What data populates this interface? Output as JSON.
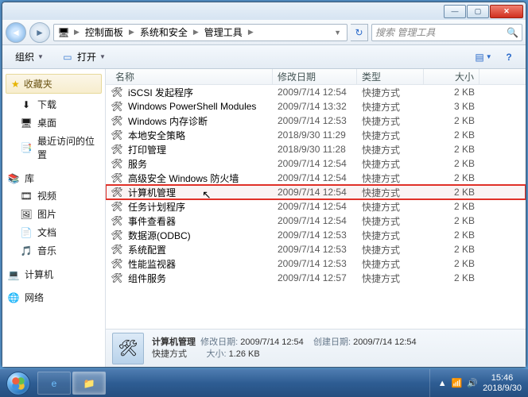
{
  "window_controls": {
    "min": "—",
    "max": "▢",
    "close": "✕"
  },
  "nav": {
    "back": "◄",
    "fwd": "►"
  },
  "breadcrumb": {
    "root_icon": "🖥",
    "items": [
      "控制面板",
      "系统和安全",
      "管理工具"
    ]
  },
  "search": {
    "icon": "🔍",
    "placeholder": "搜索 管理工具"
  },
  "toolbar": {
    "organize": "组织",
    "open": "打开",
    "view_icon": "▤",
    "help_icon": "?"
  },
  "sidebar": {
    "favorites": {
      "label": "收藏夹",
      "star": "★"
    },
    "fav_items": [
      {
        "label": "下载",
        "icon": "⬇"
      },
      {
        "label": "桌面",
        "icon": "🖥"
      },
      {
        "label": "最近访问的位置",
        "icon": "📑"
      }
    ],
    "libraries": {
      "label": "库",
      "icon": "📚"
    },
    "lib_items": [
      {
        "label": "视频",
        "icon": "🎞"
      },
      {
        "label": "图片",
        "icon": "🖼"
      },
      {
        "label": "文档",
        "icon": "📄"
      },
      {
        "label": "音乐",
        "icon": "🎵"
      }
    ],
    "computer": {
      "label": "计算机",
      "icon": "💻"
    },
    "network": {
      "label": "网络",
      "icon": "🌐"
    }
  },
  "columns": {
    "name": "名称",
    "date": "修改日期",
    "type": "类型",
    "size": "大小"
  },
  "files": [
    {
      "name": "iSCSI 发起程序",
      "date": "2009/7/14 12:54",
      "type": "快捷方式",
      "size": "2 KB",
      "hl": false
    },
    {
      "name": "Windows PowerShell Modules",
      "date": "2009/7/14 13:32",
      "type": "快捷方式",
      "size": "3 KB",
      "hl": false
    },
    {
      "name": "Windows 内存诊断",
      "date": "2009/7/14 12:53",
      "type": "快捷方式",
      "size": "2 KB",
      "hl": false
    },
    {
      "name": "本地安全策略",
      "date": "2018/9/30 11:29",
      "type": "快捷方式",
      "size": "2 KB",
      "hl": false
    },
    {
      "name": "打印管理",
      "date": "2018/9/30 11:28",
      "type": "快捷方式",
      "size": "2 KB",
      "hl": false
    },
    {
      "name": "服务",
      "date": "2009/7/14 12:54",
      "type": "快捷方式",
      "size": "2 KB",
      "hl": false
    },
    {
      "name": "高级安全 Windows 防火墙",
      "date": "2009/7/14 12:54",
      "type": "快捷方式",
      "size": "2 KB",
      "hl": false
    },
    {
      "name": "计算机管理",
      "date": "2009/7/14 12:54",
      "type": "快捷方式",
      "size": "2 KB",
      "hl": true
    },
    {
      "name": "任务计划程序",
      "date": "2009/7/14 12:54",
      "type": "快捷方式",
      "size": "2 KB",
      "hl": false
    },
    {
      "name": "事件查看器",
      "date": "2009/7/14 12:54",
      "type": "快捷方式",
      "size": "2 KB",
      "hl": false
    },
    {
      "name": "数据源(ODBC)",
      "date": "2009/7/14 12:53",
      "type": "快捷方式",
      "size": "2 KB",
      "hl": false
    },
    {
      "name": "系统配置",
      "date": "2009/7/14 12:53",
      "type": "快捷方式",
      "size": "2 KB",
      "hl": false
    },
    {
      "name": "性能监视器",
      "date": "2009/7/14 12:53",
      "type": "快捷方式",
      "size": "2 KB",
      "hl": false
    },
    {
      "name": "组件服务",
      "date": "2009/7/14 12:57",
      "type": "快捷方式",
      "size": "2 KB",
      "hl": false
    }
  ],
  "details": {
    "name": "计算机管理",
    "type_label": "快捷方式",
    "mod_label": "修改日期:",
    "mod_val": "2009/7/14 12:54",
    "create_label": "创建日期:",
    "create_val": "2009/7/14 12:54",
    "size_label": "大小:",
    "size_val": "1.26 KB"
  },
  "taskbar": {
    "tray": {
      "flag": "▲",
      "net": "📶",
      "snd": "🔊"
    },
    "clock": {
      "time": "15:46",
      "date": "2018/9/30"
    }
  }
}
